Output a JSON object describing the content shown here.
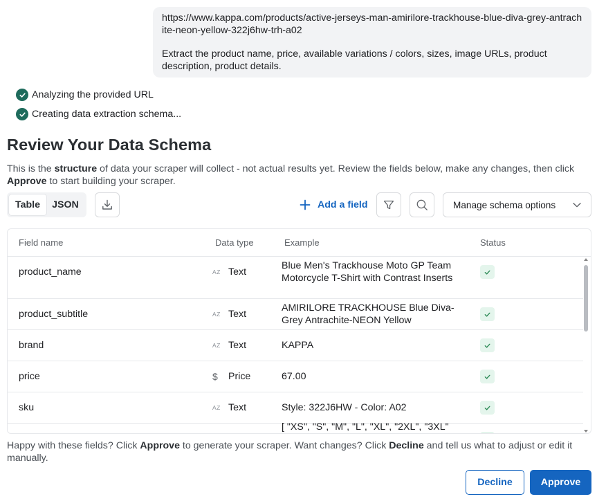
{
  "user_message": {
    "url": "https://www.kappa.com/products/active-jerseys-man-amirilore-trackhouse-blue-diva-grey-antrachite-neon-yellow-322j6hw-trh-a02",
    "request": "Extract the product name, price, available variations / colors, sizes, image URLs, product description, product details."
  },
  "steps": [
    {
      "label": "Analyzing the provided URL"
    },
    {
      "label": "Creating data extraction schema..."
    }
  ],
  "title": "Review Your Data Schema",
  "description": {
    "part1": "This is the ",
    "bold1": "structure",
    "part2": " of data your scraper will collect - not actual results yet. Review the fields below, make any changes, then click ",
    "bold2": "Approve",
    "part3": " to start building your scraper."
  },
  "toolbar": {
    "view_table": "Table",
    "view_json": "JSON",
    "add_field": "Add a field",
    "manage_options": "Manage schema options"
  },
  "table": {
    "headers": [
      "Field name",
      "Data type",
      "Example",
      "Status"
    ],
    "rows": [
      {
        "field": "product_name",
        "type": "Text",
        "type_icon": "AZ",
        "example": "Blue Men's Trackhouse Moto GP Team Motorcycle T-Shirt with Contrast Inserts"
      },
      {
        "field": "product_subtitle",
        "type": "Text",
        "type_icon": "AZ",
        "example": "AMIRILORE TRACKHOUSE Blue Diva-Grey Antrachite-NEON Yellow"
      },
      {
        "field": "brand",
        "type": "Text",
        "type_icon": "AZ",
        "example": "KAPPA"
      },
      {
        "field": "price",
        "type": "Price",
        "type_icon": "$",
        "example": "67.00"
      },
      {
        "field": "sku",
        "type": "Text",
        "type_icon": "AZ",
        "example": "Style: 322J6HW - Color: A02"
      },
      {
        "field": "",
        "type": "",
        "type_icon": "",
        "example": "[ \"XS\", \"S\", \"M\", \"L\", \"XL\", \"2XL\", \"3XL\""
      }
    ]
  },
  "footer": {
    "part1": "Happy with these fields? Click ",
    "bold1": "Approve",
    "part2": " to generate your scraper. Want changes? Click ",
    "bold2": "Decline",
    "part3": " and tell us what to adjust or edit it manually."
  },
  "buttons": {
    "decline": "Decline",
    "approve": "Approve"
  },
  "colors": {
    "accent": "#1565c0",
    "check_green": "#1e6b5c",
    "status_bg": "#e4f5ec"
  }
}
